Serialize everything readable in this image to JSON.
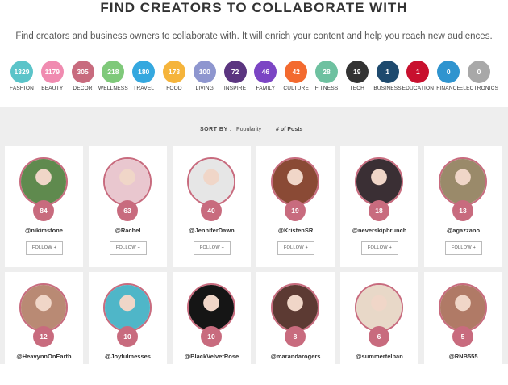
{
  "header": {
    "title": "FIND CREATORS TO COLLABORATE WITH",
    "subtitle": "Find creators and business owners to collaborate with. It will enrich your content and help you reach new audiences."
  },
  "categories": [
    {
      "label": "FASHION",
      "count": "1329",
      "color": "#5bc4c9"
    },
    {
      "label": "BEAUTY",
      "count": "1179",
      "color": "#f08bb0"
    },
    {
      "label": "DECOR",
      "count": "305",
      "color": "#c86b7e"
    },
    {
      "label": "WELLNESS",
      "count": "218",
      "color": "#7fc97a"
    },
    {
      "label": "TRAVEL",
      "count": "180",
      "color": "#35a8df"
    },
    {
      "label": "FOOD",
      "count": "173",
      "color": "#f5b43b"
    },
    {
      "label": "LIVING",
      "count": "100",
      "color": "#8e96cf"
    },
    {
      "label": "INSPIRE",
      "count": "72",
      "color": "#5b3580"
    },
    {
      "label": "FAMILY",
      "count": "46",
      "color": "#7b45c4"
    },
    {
      "label": "CULTURE",
      "count": "42",
      "color": "#f36a2f"
    },
    {
      "label": "FITNESS",
      "count": "28",
      "color": "#6ec1a0"
    },
    {
      "label": "TECH",
      "count": "19",
      "color": "#333333"
    },
    {
      "label": "BUSINESS",
      "count": "1",
      "color": "#1e4a6e"
    },
    {
      "label": "EDUCATION",
      "count": "1",
      "color": "#c8102e"
    },
    {
      "label": "FINANCE",
      "count": "0",
      "color": "#2f94cf"
    },
    {
      "label": "ELECTRONICS",
      "count": "0",
      "color": "#a8a8a8"
    }
  ],
  "sort": {
    "label": "SORT BY :",
    "options": [
      "Popularity",
      "# of Posts"
    ],
    "active": "# of Posts"
  },
  "follow_label": "FOLLOW +",
  "creators": [
    {
      "handle": "@nikimstone",
      "count": "84",
      "avatar_color": "#5f8a4e"
    },
    {
      "handle": "@Rachel",
      "count": "63",
      "avatar_color": "#e9c7cf"
    },
    {
      "handle": "@JenniferDawn",
      "count": "40",
      "avatar_color": "#e6e6e6"
    },
    {
      "handle": "@KristenSR",
      "count": "19",
      "avatar_color": "#8a4a35"
    },
    {
      "handle": "@neverskipbrunch",
      "count": "18",
      "avatar_color": "#3a2f34"
    },
    {
      "handle": "@agazzano",
      "count": "13",
      "avatar_color": "#9a8a6a"
    },
    {
      "handle": "@HeavynnOnEarth",
      "count": "12",
      "avatar_color": "#b98a74"
    },
    {
      "handle": "@Joyfulmesses",
      "count": "10",
      "avatar_color": "#4fb6c8"
    },
    {
      "handle": "@BlackVelvetRose",
      "count": "10",
      "avatar_color": "#151515"
    },
    {
      "handle": "@marandarogers",
      "count": "8",
      "avatar_color": "#5c3a33"
    },
    {
      "handle": "@summertelban",
      "count": "6",
      "avatar_color": "#e8d8c8"
    },
    {
      "handle": "@RNB555",
      "count": "5",
      "avatar_color": "#b07a66"
    }
  ]
}
